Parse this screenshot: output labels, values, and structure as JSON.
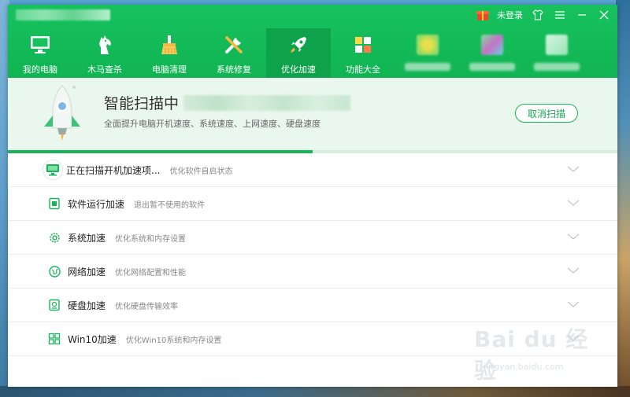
{
  "window": {
    "login_label": "未登录"
  },
  "nav": {
    "items": [
      {
        "label": "我的电脑"
      },
      {
        "label": "木马查杀"
      },
      {
        "label": "电脑清理"
      },
      {
        "label": "系统修复"
      },
      {
        "label": "优化加速"
      },
      {
        "label": "功能大全"
      }
    ],
    "active_index": 4
  },
  "scan": {
    "title": "智能扫描中",
    "subtitle": "全面提升电脑开机速度、系统速度、上网速度、硬盘速度",
    "cancel_label": "取消扫描",
    "progress_fraction": 0.5
  },
  "list": {
    "items": [
      {
        "title": "正在扫描开机加速项...",
        "desc": "优化软件自启状态",
        "icon": "monitor-icon"
      },
      {
        "title": "软件运行加速",
        "desc": "退出暂不使用的软件",
        "icon": "app-icon"
      },
      {
        "title": "系统加速",
        "desc": "优化系统和内存设置",
        "icon": "gear-icon"
      },
      {
        "title": "网络加速",
        "desc": "优化网络配置和性能",
        "icon": "globe-icon"
      },
      {
        "title": "硬盘加速",
        "desc": "优化硬盘传输效率",
        "icon": "disk-icon"
      },
      {
        "title": "Win10加速",
        "desc": "优化Win10系统和内存设置",
        "icon": "windows-icon"
      }
    ]
  },
  "watermark": {
    "brand": "Bai du 经验",
    "url": "jingyan.baidu.com"
  },
  "colors": {
    "brand_green": "#16c25d",
    "active_tab": "#0ea24a",
    "panel_bg": "#eaf7ef"
  }
}
